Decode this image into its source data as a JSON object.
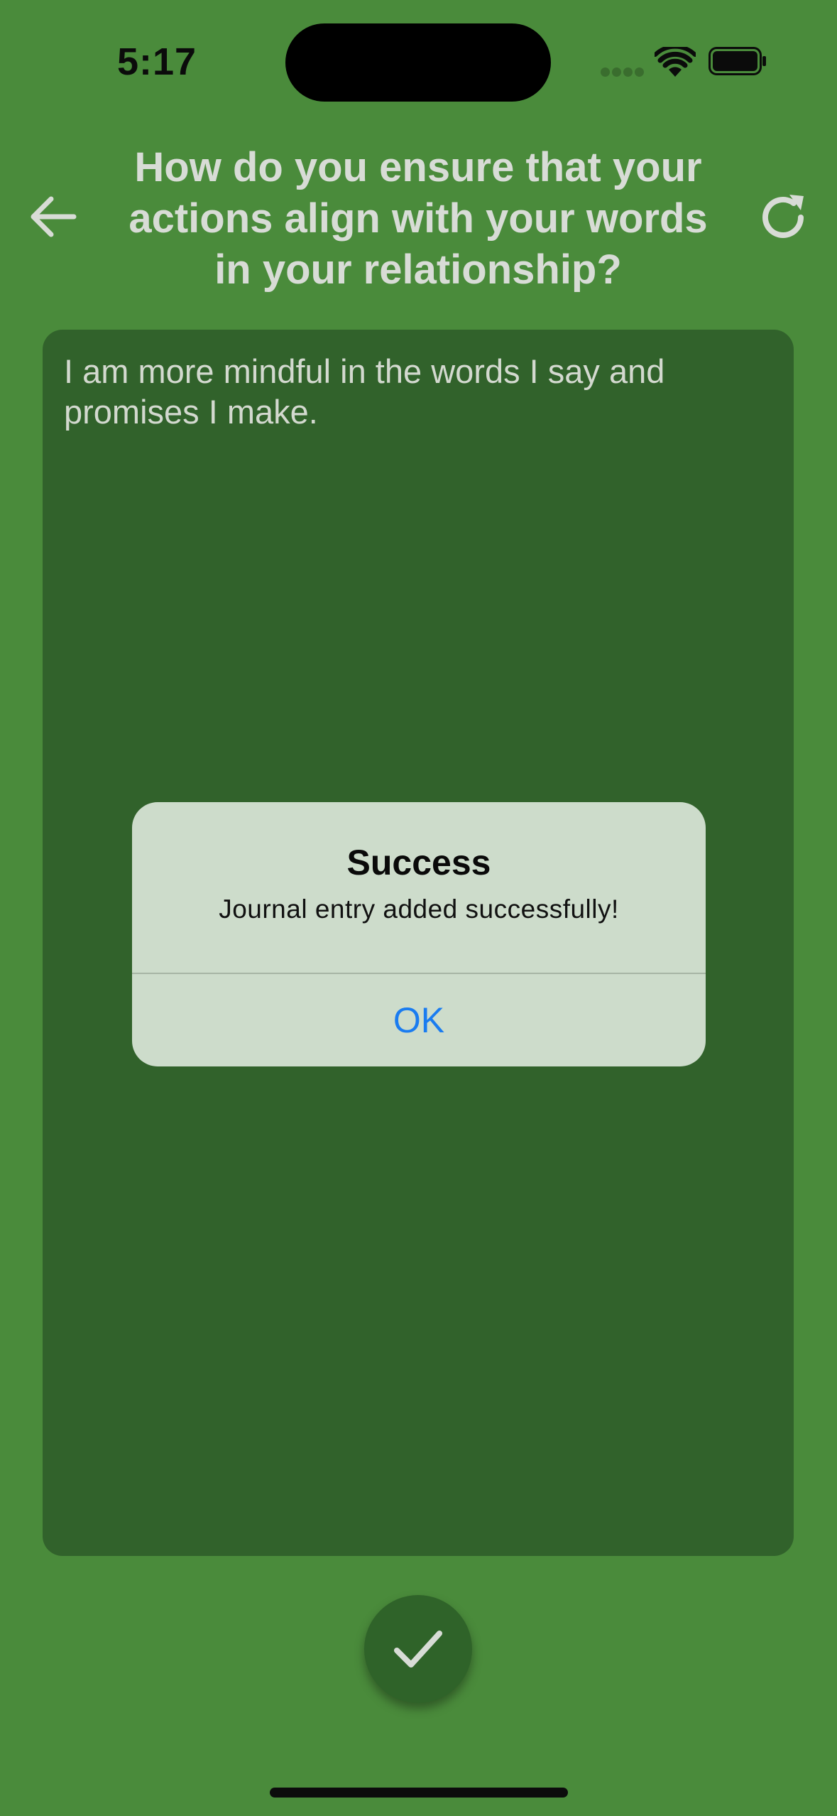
{
  "status_bar": {
    "time": "5:17",
    "icons": [
      "cellular-signal-icon",
      "wifi-icon",
      "battery-icon"
    ]
  },
  "header": {
    "title": "How do you ensure that your actions align with your words in your relationship?",
    "back_icon": "arrow-left-icon",
    "refresh_icon": "refresh-icon"
  },
  "journal": {
    "entry_text": "I am more mindful in the words I say and promises I make."
  },
  "alert": {
    "title": "Success",
    "message": "Journal entry added successfully!",
    "ok_label": "OK"
  },
  "submit": {
    "icon": "checkmark-icon"
  },
  "colors": {
    "background": "#4a8b3b",
    "card": "#31622b",
    "alert_bg": "#cddccb",
    "alert_button": "#1a7cf0",
    "text_light": "#d8dcd6"
  }
}
